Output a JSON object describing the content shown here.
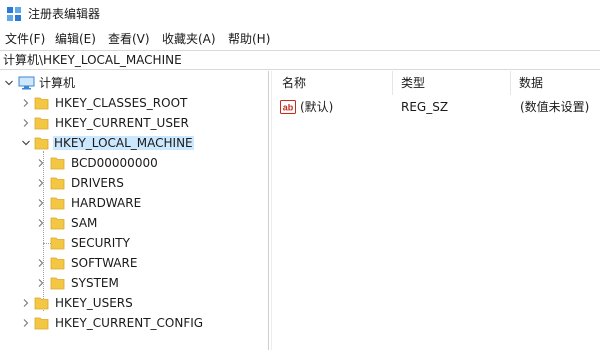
{
  "window": {
    "title": "注册表编辑器"
  },
  "menu": {
    "items": [
      {
        "label": "文件(F)",
        "name": "menu-file"
      },
      {
        "label": "编辑(E)",
        "name": "menu-edit"
      },
      {
        "label": "查看(V)",
        "name": "menu-view"
      },
      {
        "label": "收藏夹(A)",
        "name": "menu-favorites"
      },
      {
        "label": "帮助(H)",
        "name": "menu-help"
      }
    ]
  },
  "address": {
    "path": "计算机\\HKEY_LOCAL_MACHINE"
  },
  "tree": {
    "root": {
      "label": "计算机",
      "icon": "computer-icon",
      "expanded": true
    },
    "hives": [
      {
        "label": "HKEY_CLASSES_ROOT",
        "expanded": false,
        "selected": false
      },
      {
        "label": "HKEY_CURRENT_USER",
        "expanded": false,
        "selected": false
      },
      {
        "label": "HKEY_LOCAL_MACHINE",
        "expanded": true,
        "selected": true
      },
      {
        "label": "HKEY_USERS",
        "expanded": false,
        "selected": false
      },
      {
        "label": "HKEY_CURRENT_CONFIG",
        "expanded": false,
        "selected": false
      }
    ],
    "hklm_children": [
      {
        "label": "BCD00000000",
        "has_children": true
      },
      {
        "label": "DRIVERS",
        "has_children": true
      },
      {
        "label": "HARDWARE",
        "has_children": true
      },
      {
        "label": "SAM",
        "has_children": true
      },
      {
        "label": "SECURITY",
        "has_children": false
      },
      {
        "label": "SOFTWARE",
        "has_children": true
      },
      {
        "label": "SYSTEM",
        "has_children": true
      }
    ]
  },
  "list": {
    "columns": [
      "名称",
      "类型",
      "数据"
    ],
    "rows": [
      {
        "name": "(默认)",
        "type": "REG_SZ",
        "data": "(数值未设置)",
        "icon": "string-value-icon"
      }
    ]
  },
  "colors": {
    "selection": "#cce8ff",
    "folder": "#f3c744",
    "folder_dark": "#e0a82e",
    "value_icon_red": "#c42b1c"
  }
}
